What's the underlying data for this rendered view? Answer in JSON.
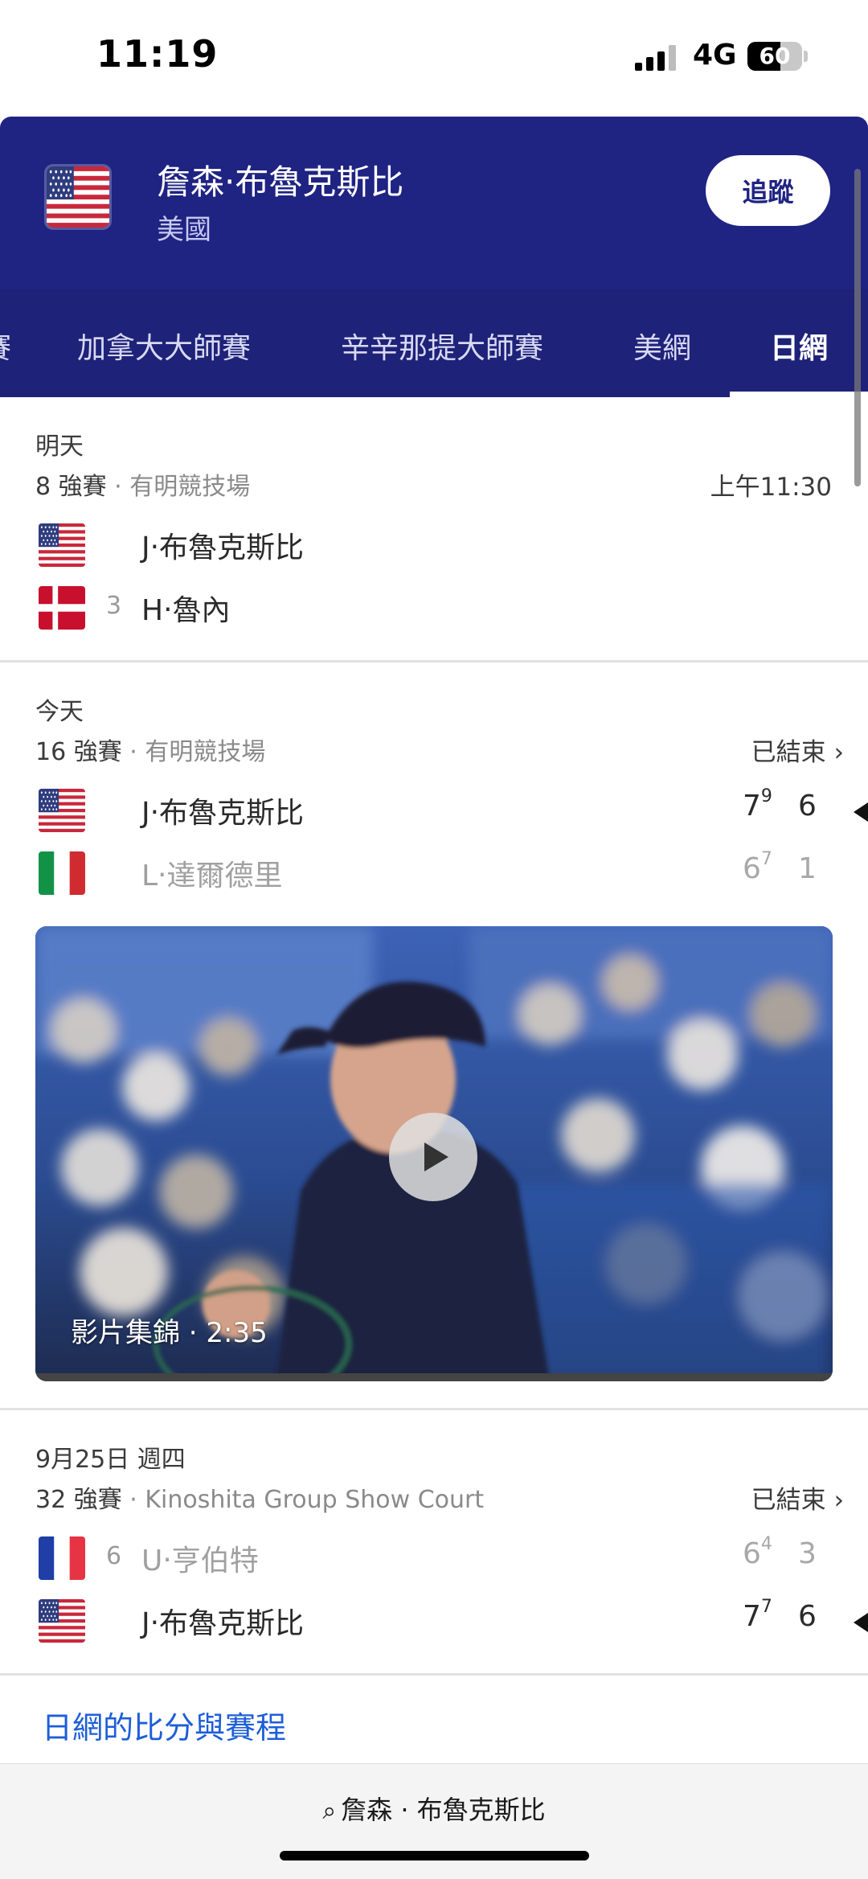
{
  "status_bar": {
    "time": "11:19",
    "network": "4G",
    "battery": "60",
    "battery_fraction": 0.6
  },
  "header": {
    "player_name": "詹森‧布魯克斯比",
    "country": "美國",
    "follow_label": "追蹤"
  },
  "tabs": [
    {
      "label": "賽"
    },
    {
      "label": "加拿大大師賽"
    },
    {
      "label": "辛辛那提大師賽"
    },
    {
      "label": "美網"
    },
    {
      "label": "日網",
      "active": true
    }
  ],
  "matches": [
    {
      "day": "明天",
      "round": "8 強賽",
      "venue": " · 有明競技場",
      "time": "上午11:30",
      "players": [
        {
          "flag": "usa-flag",
          "seed": "",
          "name": "J‧布魯克斯比"
        },
        {
          "flag": "denmark-flag",
          "seed": "3",
          "name": "H‧魯內"
        }
      ]
    },
    {
      "day": "今天",
      "round": "16 強賽",
      "venue": " · 有明競技場",
      "status": "已結束",
      "players": [
        {
          "flag": "usa-flag",
          "seed": "",
          "name": "J‧布魯克斯比",
          "sets": [
            {
              "v": "7",
              "tb": "9"
            },
            {
              "v": "6",
              "tb": ""
            }
          ],
          "winner": true
        },
        {
          "flag": "italy-flag",
          "seed": "",
          "name": "L‧達爾德里",
          "sets": [
            {
              "v": "6",
              "tb": "7"
            },
            {
              "v": "1",
              "tb": ""
            }
          ],
          "winner": false
        }
      ],
      "video": {
        "caption": "影片集錦 · 2:35"
      }
    },
    {
      "day": "9月25日 週四",
      "round": "32 強賽",
      "venue": " · Kinoshita Group Show Court",
      "status": "已結束",
      "players": [
        {
          "flag": "france-flag",
          "seed": "6",
          "name": "U‧亨伯特",
          "sets": [
            {
              "v": "6",
              "tb": "4"
            },
            {
              "v": "3",
              "tb": ""
            }
          ],
          "winner": false
        },
        {
          "flag": "usa-flag",
          "seed": "",
          "name": "J‧布魯克斯比",
          "sets": [
            {
              "v": "7",
              "tb": "7"
            },
            {
              "v": "6",
              "tb": ""
            }
          ],
          "winner": true
        }
      ]
    }
  ],
  "footer_link": "日網的比分與賽程",
  "search": {
    "query": "詹森 · 布魯克斯比"
  },
  "colors": {
    "header": "#1f2382",
    "tabs": "#1e2278",
    "link": "#1d5ed8"
  }
}
